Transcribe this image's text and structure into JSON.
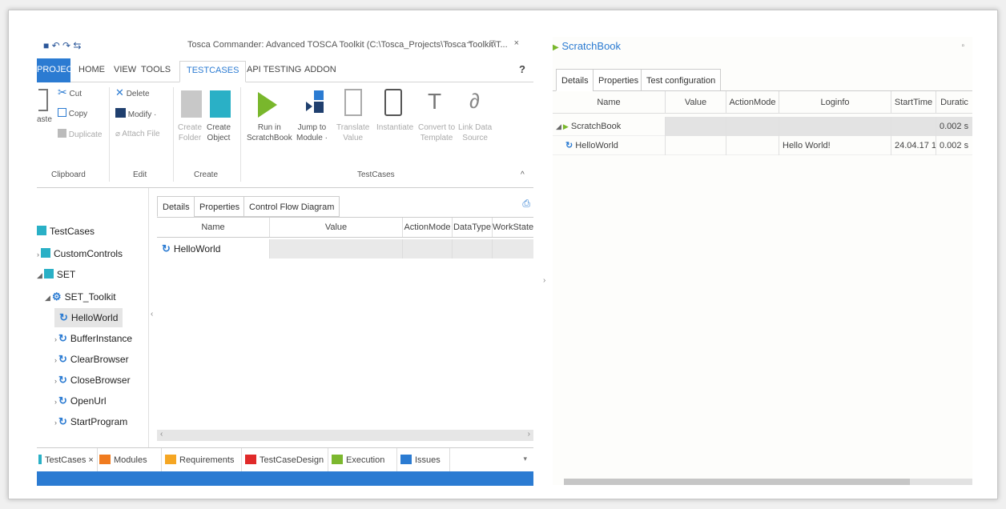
{
  "window": {
    "title": "Tosca Commander: Advanced TOSCA Toolkit (C:\\Tosca_Projects\\Tosca Toolkit\\T...",
    "controls": "▫ − □ ×"
  },
  "ribbon_tabs": [
    "PROJECT",
    "HOME",
    "VIEW",
    "TOOLS",
    "TESTCASES",
    "API TESTING",
    "ADDON"
  ],
  "help": "?",
  "ribbon": {
    "clipboard": {
      "paste": "aste",
      "cut": "Cut",
      "copy": "Copy",
      "duplicate": "Duplicate",
      "group": "Clipboard"
    },
    "edit": {
      "delete": "Delete",
      "modify": "Modify ·",
      "attach": "Attach File",
      "group": "Edit"
    },
    "create": {
      "folder": "Create\nFolder",
      "object": "Create\nObject",
      "group": "Create"
    },
    "testcases": {
      "run": "Run in\nScratchBook",
      "jump": "Jump to\nModule ·",
      "translate": "Translate\nValue",
      "instantiate": "Instantiate",
      "convert": "Convert to\nTemplate",
      "link": "Link Data\nSource",
      "group": "TestCases"
    },
    "collapse": "^"
  },
  "tree": {
    "items": [
      {
        "label": "TestCases"
      },
      {
        "label": "CustomControls"
      },
      {
        "label": "SET"
      },
      {
        "label": "SET_Toolkit"
      },
      {
        "label": "HelloWorld"
      },
      {
        "label": "BufferInstance"
      },
      {
        "label": "ClearBrowser"
      },
      {
        "label": "CloseBrowser"
      },
      {
        "label": "OpenUrl"
      },
      {
        "label": "StartProgram"
      }
    ]
  },
  "details": {
    "tabs": [
      "Details",
      "Properties",
      "Control Flow Diagram"
    ],
    "columns": [
      "Name",
      "Value",
      "ActionMode",
      "DataType",
      "WorkState"
    ],
    "row_name": "HelloWorld"
  },
  "bottom_tabs": [
    {
      "label": "TestCases  ×",
      "color": "#2ab0c6"
    },
    {
      "label": "Modules",
      "color": "#f07b1f"
    },
    {
      "label": "Requirements",
      "color": "#f5a623"
    },
    {
      "label": "TestCaseDesign",
      "color": "#e02a2a"
    },
    {
      "label": "Execution",
      "color": "#7cb82f"
    },
    {
      "label": "Issues",
      "color": "#2b7bd2"
    }
  ],
  "scratchbook": {
    "title": "ScratchBook",
    "tabs": [
      "Details",
      "Properties",
      "Test configuration"
    ],
    "columns": [
      "Name",
      "Value",
      "ActionMode",
      "Loginfo",
      "StartTime",
      "Duratic"
    ],
    "rows": [
      {
        "name": "ScratchBook",
        "value": "",
        "actionmode": "",
        "loginfo": "",
        "starttime": "",
        "duration": "0.002 s"
      },
      {
        "name": "HelloWorld",
        "value": "",
        "actionmode": "",
        "loginfo": "Hello World!",
        "starttime": "24.04.17 1...",
        "duration": "0.002 s"
      }
    ]
  }
}
